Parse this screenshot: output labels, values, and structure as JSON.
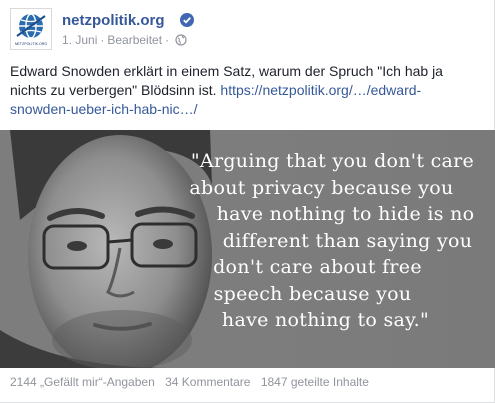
{
  "post": {
    "page_name": "netzpolitik.org",
    "avatar_caption": "NETZPOLITIK.ORG",
    "date": "1. Juni",
    "edited": "Bearbeitet",
    "separator": "·",
    "text": "Edward Snowden erklärt in einem Satz, warum der Spruch \"Ich hab ja nichts zu verbergen\" Blödsinn ist.",
    "link": "https://netzpolitik.org/…/edward-snowden-ueber-ich-hab-nic…/",
    "quote_lines": [
      "\"Arguing that you don't care",
      "about privacy because you",
      "have nothing to hide is no",
      "different than saying you",
      "don't care about free",
      "speech because you",
      "have nothing to say.\""
    ],
    "likes": "2144 „Gefällt mir“-Angaben",
    "comments": "34 Kommentare",
    "shares": "1847 geteilte Inhalte"
  },
  "colors": {
    "link_blue": "#365899",
    "meta_gray": "#90949c",
    "verified_blue": "#4267b2"
  },
  "icons": [
    "netzpolitik-logo-icon",
    "verified-badge-icon",
    "globe-icon"
  ]
}
